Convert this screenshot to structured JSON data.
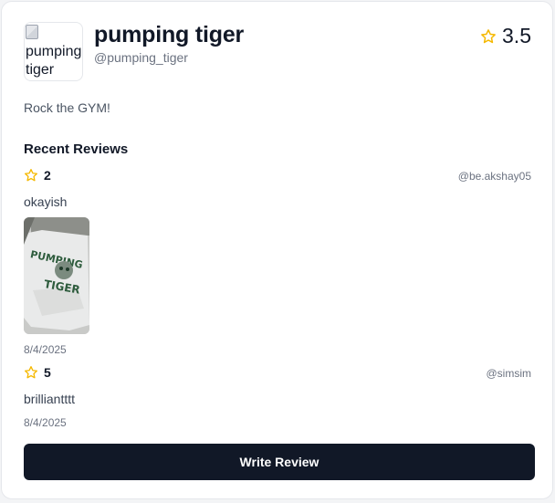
{
  "profile": {
    "logo_alt": "pumping tiger",
    "name": "pumping tiger",
    "handle": "@pumping_tiger",
    "rating": "3.5",
    "bio": "Rock the GYM!"
  },
  "reviews_section": {
    "title": "Recent Reviews",
    "items": [
      {
        "rating": "2",
        "user": "@be.akshay05",
        "text": "okayish",
        "has_photo": true,
        "photo_text_line1": "PUMPING",
        "photo_text_line2": "TIGER",
        "date": "8/4/2025"
      },
      {
        "rating": "5",
        "user": "@simsim",
        "text": "brilliantttt",
        "has_photo": false,
        "date": "8/4/2025"
      }
    ]
  },
  "actions": {
    "write_review_label": "Write Review"
  },
  "colors": {
    "star": "#f5b800",
    "button_bg": "#111827"
  },
  "icons": [
    "star-outline-icon",
    "broken-image-icon"
  ]
}
